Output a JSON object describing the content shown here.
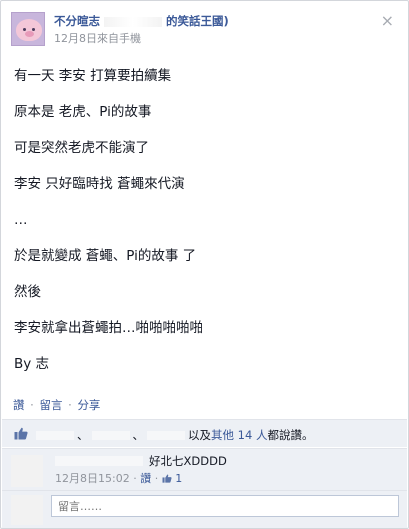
{
  "post": {
    "author_prefix": "不分暄志",
    "author_suffix": "的笑話王國)",
    "timestamp": "12月8日",
    "via": "來自手機",
    "close_label": "×",
    "lines": [
      "有一天 李安 打算要拍續集",
      "原本是 老虎、Pi的故事",
      "可是突然老虎不能演了",
      "李安 只好臨時找 蒼蠅來代演",
      "…",
      "於是就變成 蒼蠅、Pi的故事 了",
      "然後",
      "李安就拿出蒼蠅拍…啪啪啪啪啪",
      "By 志"
    ]
  },
  "actions": {
    "like": "讚",
    "comment": "留言",
    "share": "分享",
    "separator": "·"
  },
  "likes": {
    "separator": "、",
    "and_others": "以及",
    "others_link": "其他 14 人",
    "suffix": "都說讚。"
  },
  "comment": {
    "text": "好北七XDDDD",
    "timestamp": "12月8日15:02",
    "like_label": "讚",
    "like_count": "1",
    "separator": "·"
  },
  "composer": {
    "placeholder": "留言……"
  },
  "colors": {
    "link": "#3b5998",
    "meta": "#90949c",
    "panel": "#edf0f5"
  }
}
